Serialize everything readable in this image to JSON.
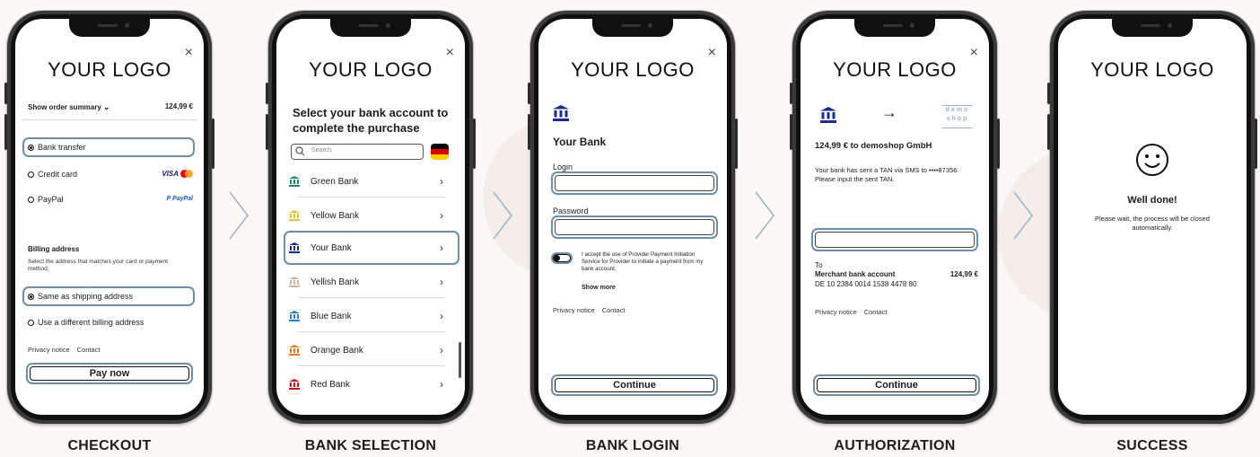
{
  "colors": {
    "accent_border": "#6e8fa8",
    "bank_blue": "#1c2b8e",
    "visa_blue": "#1a1f71",
    "paypal_blue": "#1e5bb8"
  },
  "logo_text": "YOUR LOGO",
  "close_glyph": "×",
  "steps": [
    {
      "caption": "CHECKOUT"
    },
    {
      "caption": "BANK SELECTION"
    },
    {
      "caption": "BANK LOGIN"
    },
    {
      "caption": "AUTHORIZATION"
    },
    {
      "caption": "SUCCESS"
    }
  ],
  "checkout": {
    "order_summary_label": "Show order summary",
    "order_total": "124,99 €",
    "methods": [
      {
        "label": "Bank transfer",
        "selected": true
      },
      {
        "label": "Credit card",
        "selected": false,
        "badge": "VISA"
      },
      {
        "label": "PayPal",
        "selected": false,
        "badge": "PayPal"
      }
    ],
    "billing_title": "Billing address",
    "billing_desc": "Select the address that matches your card or payment method.",
    "billing_options": [
      {
        "label": "Same as shipping address",
        "selected": true
      },
      {
        "label": "Use a different billing address",
        "selected": false
      }
    ],
    "privacy": "Privacy notice",
    "contact": "Contact",
    "pay_button": "Pay now"
  },
  "bank_selection": {
    "title": "Select your bank account to complete the purchase",
    "search_placeholder": "Search",
    "banks": [
      {
        "name": "Green Bank",
        "color": "#1f8f5f"
      },
      {
        "name": "Yellow Bank",
        "color": "#e8c33a"
      },
      {
        "name": "Your Bank",
        "color": "#1c2b8e",
        "selected": true
      },
      {
        "name": "Yellish Bank",
        "color": "#c9b89a"
      },
      {
        "name": "Blue Bank",
        "color": "#2a7fd4"
      },
      {
        "name": "Orange Bank",
        "color": "#e07a1e"
      },
      {
        "name": "Red Bank",
        "color": "#c8161d"
      }
    ]
  },
  "bank_login": {
    "bank_name": "Your Bank",
    "login_label": "Login",
    "password_label": "Password",
    "consent": "I accept the use of Provider Payment Initiation Service for Provider to initiate a payment from my bank account.",
    "show_more": "Show more",
    "privacy": "Privacy notice",
    "contact": "Contact",
    "continue": "Continue"
  },
  "authorization": {
    "arrow": "→",
    "demo_logo_line1": "demo",
    "demo_logo_line2": "shop",
    "headline": "124,99 € to demoshop GmbH",
    "info": "Your bank has sent a TAN via SMS to ••••87356. Please input the sent TAN.",
    "to_label": "To",
    "account_label": "Merchant bank account",
    "amount": "124,99 €",
    "iban": "DE 10 2384 0014 1538 4478 80",
    "privacy": "Privacy notice",
    "contact": "Contact",
    "continue": "Continue"
  },
  "success": {
    "title": "Well done!",
    "message": "Please wait, the process will be closed automatically."
  }
}
